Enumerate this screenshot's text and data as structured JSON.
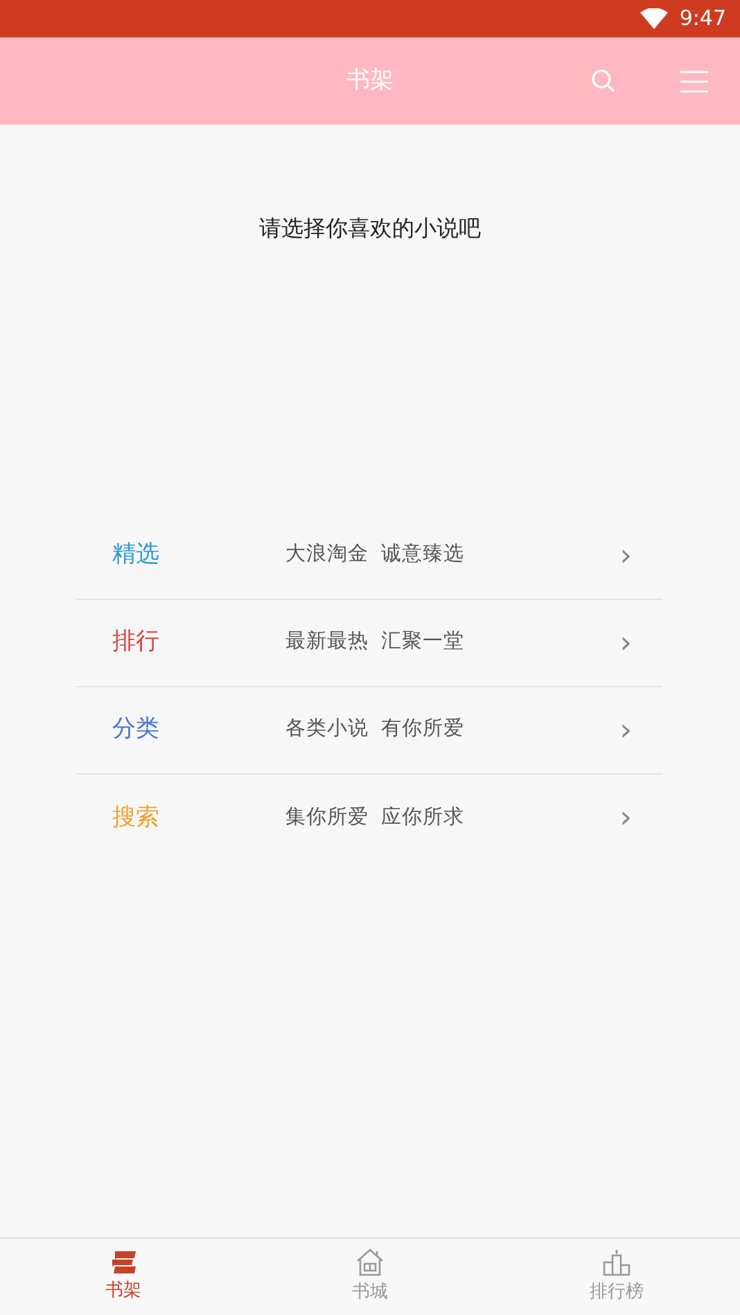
{
  "status_bar": {
    "time": "9:47"
  },
  "header": {
    "title": "书架"
  },
  "prompt": "请选择你喜欢的小说吧",
  "menu": [
    {
      "title": "精选",
      "subtitle": "大浪淘金  诚意臻选",
      "color": "#2a9ad8",
      "chevron": "›"
    },
    {
      "title": "排行",
      "subtitle": "最新最热  汇聚一堂",
      "color": "#d9403a",
      "chevron": "›"
    },
    {
      "title": "分类",
      "subtitle": "各类小说  有你所爱",
      "color": "#4a6fd6",
      "chevron": "›"
    },
    {
      "title": "搜索",
      "subtitle": "集你所爱  应你所求",
      "color": "#f0a030",
      "chevron": "›"
    }
  ],
  "tabs": [
    {
      "kind": "shelf",
      "label": "书架",
      "selected": true
    },
    {
      "kind": "store",
      "label": "书城",
      "selected": false
    },
    {
      "kind": "rank",
      "label": "排行榜",
      "selected": false
    }
  ]
}
